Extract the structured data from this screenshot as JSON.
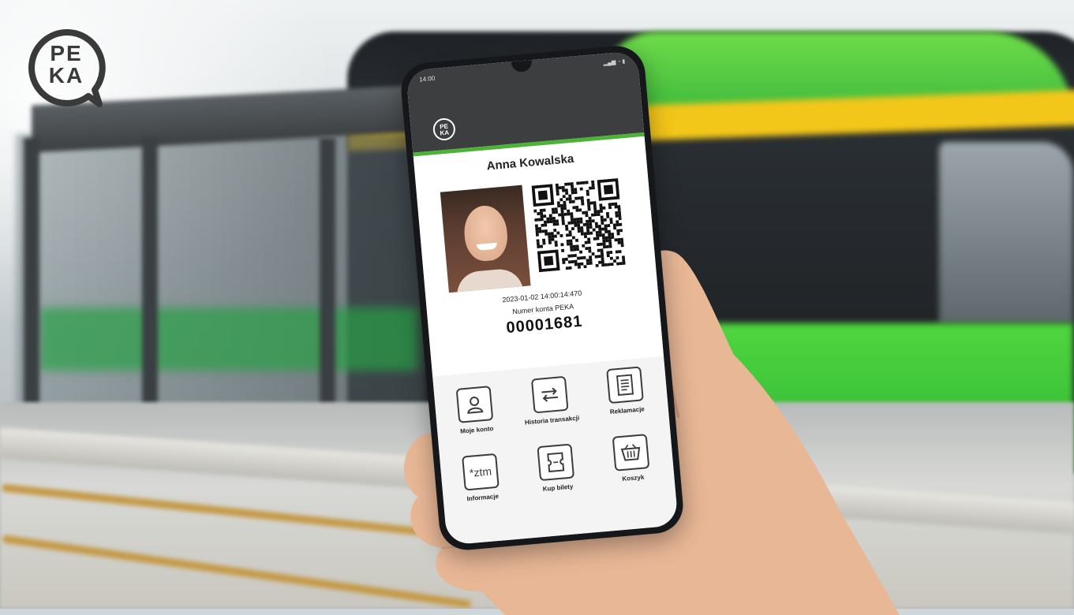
{
  "brand": {
    "logo_text": "PE KA",
    "accent_green": "#4cb336",
    "header_color": "#3d3e40"
  },
  "status_bar": {
    "time": "14:00",
    "icons": "signal-wifi-battery"
  },
  "card": {
    "user_name": "Anna Kowalska",
    "timestamp": "2023-01-02 14:00:14:470",
    "account_label": "Numer konta PEKA",
    "account_number": "00001681",
    "photo_icon": "user-photo",
    "qr_icon": "qr-code"
  },
  "menu": {
    "items": [
      {
        "label": "Moje konto",
        "icon": "user-icon"
      },
      {
        "label": "Historia transakcji",
        "icon": "transfer-arrows-icon"
      },
      {
        "label": "Reklamacje",
        "icon": "document-icon"
      },
      {
        "label": "Informacje",
        "icon": "ztm-icon",
        "icon_text": "*ztm"
      },
      {
        "label": "Kup bilety",
        "icon": "ticket-icon"
      },
      {
        "label": "Koszyk",
        "icon": "basket-icon"
      }
    ]
  }
}
